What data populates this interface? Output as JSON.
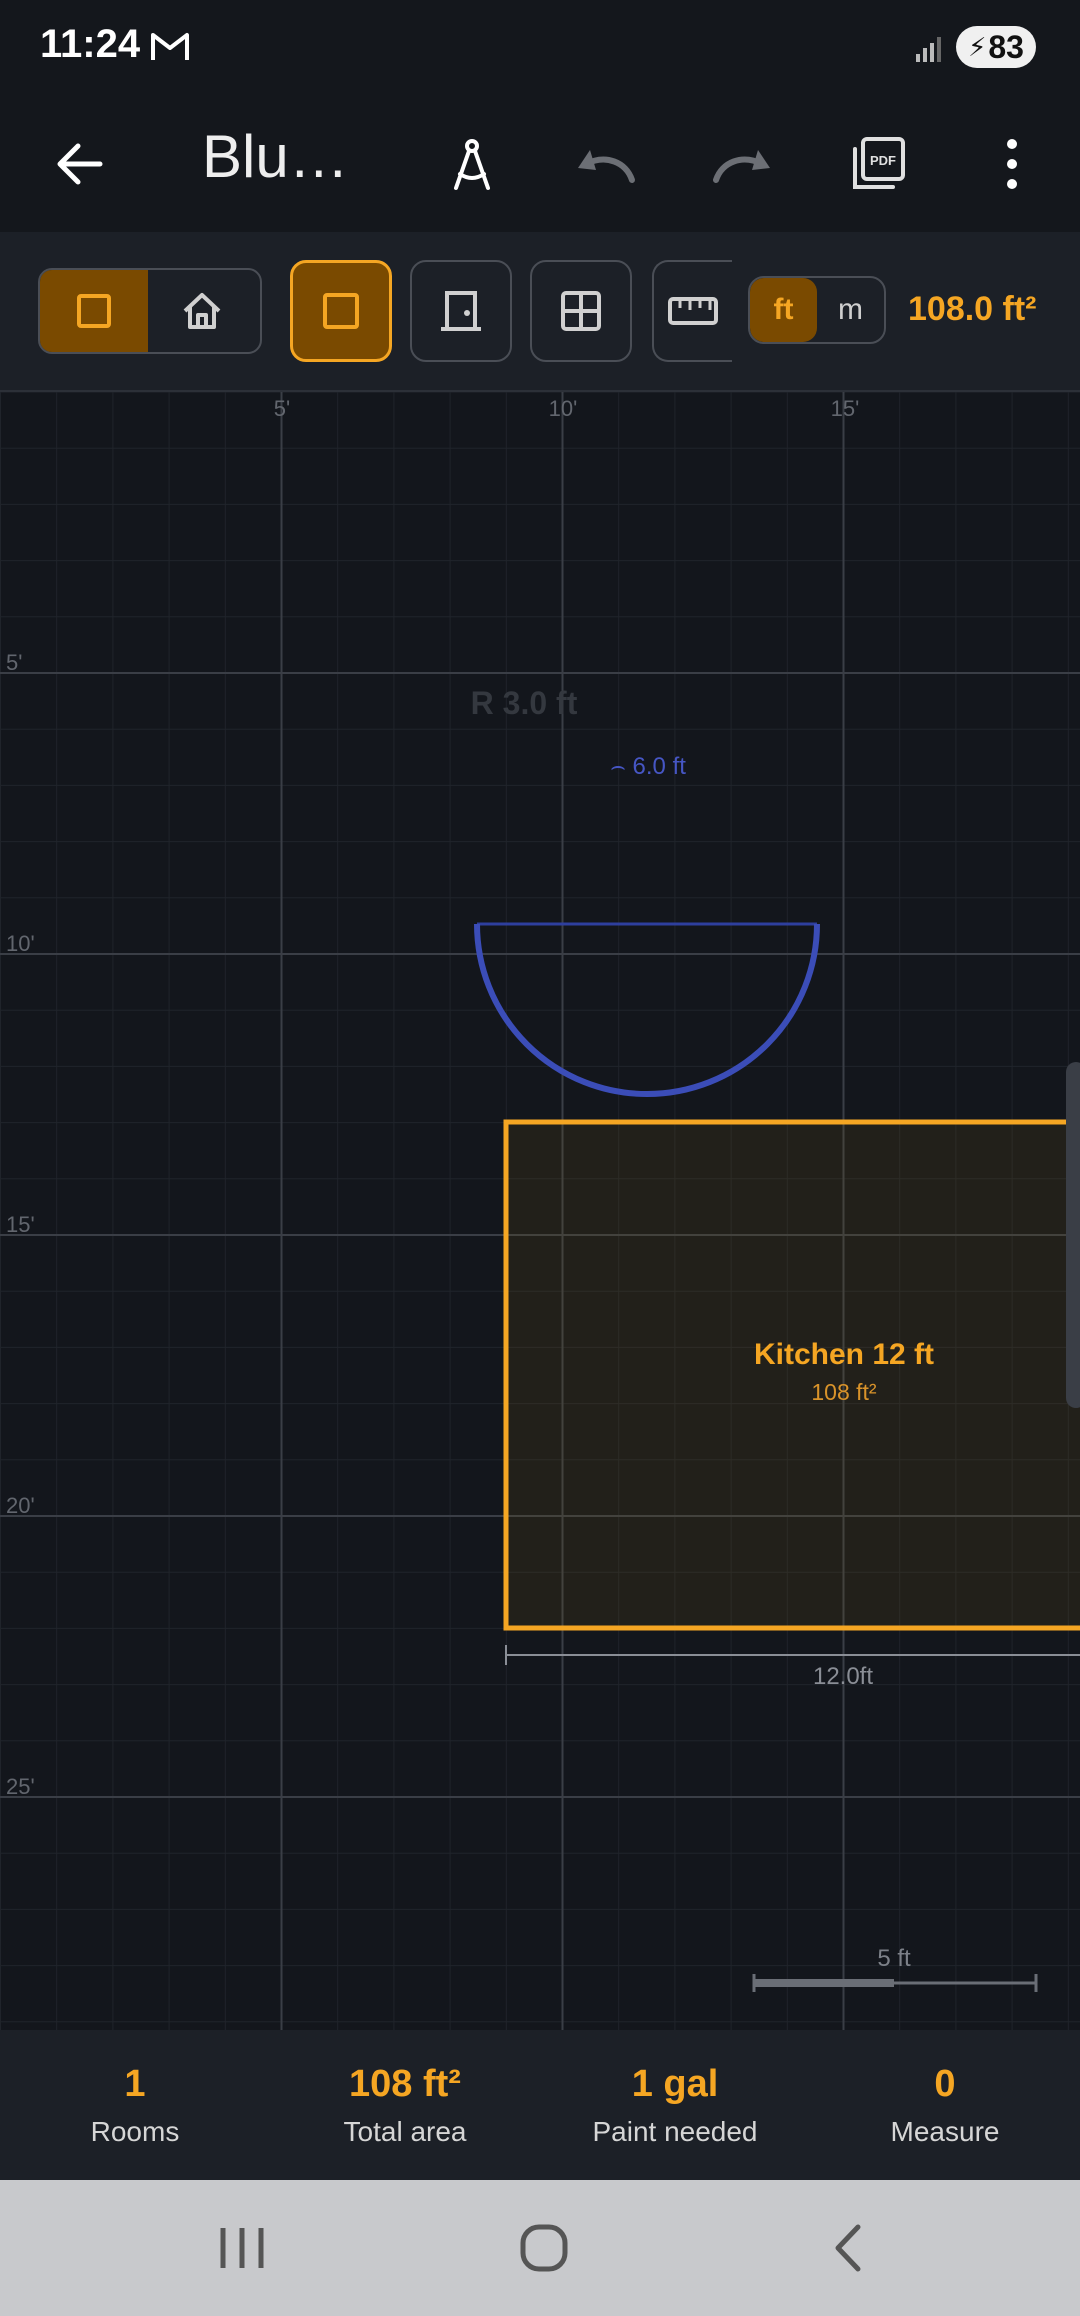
{
  "status_bar": {
    "time": "11:24",
    "battery": "83"
  },
  "app_bar": {
    "title": "Blu…"
  },
  "toolbar": {
    "units": [
      "ft",
      "m"
    ],
    "active_unit": "ft",
    "area": "108.0 ft²"
  },
  "canvas": {
    "ruler_x": [
      "5'",
      "10'",
      "15'"
    ],
    "ruler_y": [
      "5'",
      "10'",
      "15'",
      "20'",
      "25'"
    ],
    "arc_radius_label": "R 3.0 ft",
    "arc_length_label": "⌢ 6.0 ft",
    "room": {
      "name": "Kitchen 12 ft",
      "area": "108 ft²",
      "dimension": "12.0ft"
    },
    "scale_label": "5 ft"
  },
  "stats": [
    {
      "value": "1",
      "label": "Rooms"
    },
    {
      "value": "108 ft²",
      "label": "Total area"
    },
    {
      "value": "1 gal",
      "label": "Paint needed"
    },
    {
      "value": "0",
      "label": "Measure"
    }
  ],
  "colors": {
    "accent": "#f5a623",
    "arc": "#3b4db8",
    "background": "#13161c"
  }
}
